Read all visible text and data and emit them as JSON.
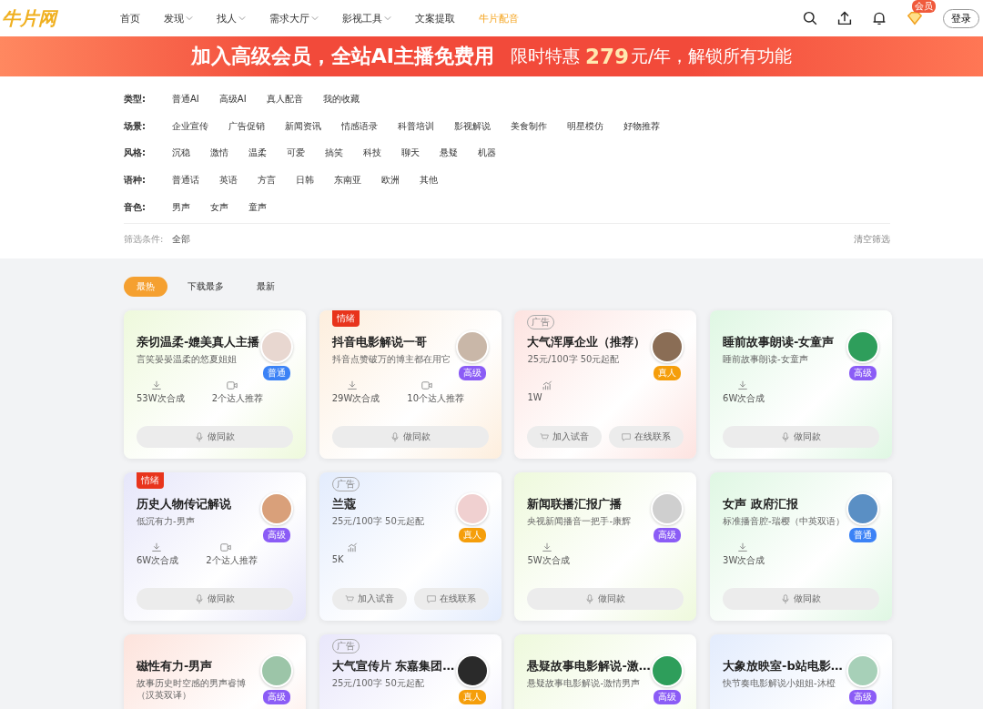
{
  "header": {
    "logo": "牛片网",
    "nav": [
      {
        "label": "首页",
        "dropdown": false,
        "selected": false
      },
      {
        "label": "发现",
        "dropdown": true,
        "selected": false
      },
      {
        "label": "找人",
        "dropdown": true,
        "selected": false
      },
      {
        "label": "需求大厅",
        "dropdown": true,
        "selected": false
      },
      {
        "label": "影视工具",
        "dropdown": true,
        "selected": false
      },
      {
        "label": "文案提取",
        "dropdown": false,
        "selected": false
      },
      {
        "label": "牛片配音",
        "dropdown": false,
        "selected": true
      }
    ],
    "vip_badge": "会员",
    "login": "登录"
  },
  "banner": {
    "headline": "加入高级会员，全站AI主播免费用",
    "offer_prefix": "限时特惠",
    "price": "279",
    "offer_suffix": "元/年，解锁所有功能"
  },
  "filters": [
    {
      "label": "类型:",
      "options": [
        "普通AI",
        "高级AI",
        "真人配音",
        "我的收藏"
      ]
    },
    {
      "label": "场景:",
      "options": [
        "企业宣传",
        "广告促销",
        "新闻资讯",
        "情感语录",
        "科普培训",
        "影视解说",
        "美食制作",
        "明星模仿",
        "好物推荐"
      ]
    },
    {
      "label": "风格:",
      "options": [
        "沉稳",
        "激情",
        "温柔",
        "可爱",
        "搞笑",
        "科技",
        "聊天",
        "悬疑",
        "机器"
      ]
    },
    {
      "label": "语种:",
      "options": [
        "普通话",
        "英语",
        "方言",
        "日韩",
        "东南亚",
        "欧洲",
        "其他"
      ]
    },
    {
      "label": "音色:",
      "options": [
        "男声",
        "女声",
        "童声"
      ]
    }
  ],
  "filter_summary": {
    "label": "筛选条件:",
    "value": "全部",
    "clear": "清空筛选"
  },
  "sort_tabs": [
    {
      "label": "最热",
      "selected": true
    },
    {
      "label": "下载最多",
      "selected": false
    },
    {
      "label": "最新",
      "selected": false
    }
  ],
  "cards": [
    {
      "kind": "voice",
      "title": "亲切温柔-媲美真人主播",
      "subtitle": "言笑晏晏温柔的悠夏姐姐",
      "badge": "普通",
      "color": "#3b82f6",
      "downloads": "53W次合成",
      "recommend": "2个达人推荐",
      "action": "做同款"
    },
    {
      "kind": "voice",
      "ribbon": "情绪",
      "title": "抖音电影解说一哥",
      "subtitle": "抖音点赞破万的博主都在用它",
      "badge": "高级",
      "color": "#8b5cf6",
      "downloads": "29W次合成",
      "recommend": "10个达人推荐",
      "action": "做同款"
    },
    {
      "kind": "ad",
      "ad_tag": "广告",
      "title": "大气浑厚企业（推荐）",
      "subtitle": "25元/100字 50元起配",
      "badge": "真人",
      "color": "#f59e0b",
      "trend": "1W",
      "actions": [
        "加入试音",
        "在线联系"
      ]
    },
    {
      "kind": "voice",
      "title": "睡前故事朗读-女童声",
      "subtitle": "睡前故事朗读-女童声",
      "badge": "高级",
      "color": "#8b5cf6",
      "downloads": "6W次合成",
      "action": "做同款"
    },
    {
      "kind": "voice",
      "ribbon": "情绪",
      "title": "历史人物传记解说",
      "subtitle": "低沉有力-男声",
      "badge": "高级",
      "color": "#8b5cf6",
      "downloads": "6W次合成",
      "recommend": "2个达人推荐",
      "action": "做同款"
    },
    {
      "kind": "ad",
      "ad_tag": "广告",
      "title": "兰蔻",
      "subtitle": "25元/100字 50元起配",
      "badge": "真人",
      "color": "#f59e0b",
      "trend": "5K",
      "actions": [
        "加入试音",
        "在线联系"
      ]
    },
    {
      "kind": "voice",
      "title": "新闻联播汇报广播",
      "subtitle": "央视新闻播音一把手-康辉",
      "badge": "高级",
      "color": "#8b5cf6",
      "downloads": "5W次合成",
      "action": "做同款"
    },
    {
      "kind": "voice",
      "title": "女声 政府汇报",
      "subtitle": "标准播音腔-瑞樱（中英双语）",
      "badge": "普通",
      "color": "#3b82f6",
      "downloads": "3W次合成",
      "action": "做同款"
    },
    {
      "kind": "voice",
      "title": "磁性有力-男声",
      "subtitle": "故事历史时空感的男声睿博（汉英双译）",
      "badge": "高级",
      "color": "#8b5cf6"
    },
    {
      "kind": "ad",
      "ad_tag": "广告",
      "title": "大气宣传片 东嘉集团…",
      "subtitle": "25元/100字 50元起配",
      "badge": "真人",
      "color": "#f59e0b"
    },
    {
      "kind": "voice",
      "title": "悬疑故事电影解说-激…",
      "subtitle": "悬疑故事电影解说-激情男声",
      "badge": "高级",
      "color": "#8b5cf6"
    },
    {
      "kind": "voice",
      "title": "大象放映室-b站电影…",
      "subtitle": "快节奏电影解说小姐姐-沐橙",
      "badge": "高级",
      "color": "#8b5cf6"
    }
  ]
}
